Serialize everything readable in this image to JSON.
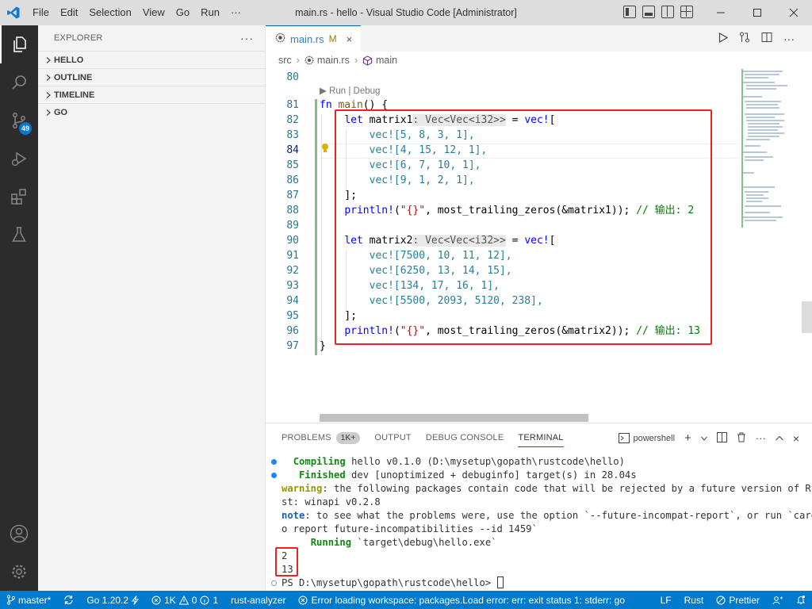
{
  "window": {
    "title": "main.rs - hello - Visual Studio Code [Administrator]",
    "menu": [
      "File",
      "Edit",
      "Selection",
      "View",
      "Go",
      "Run",
      "···"
    ]
  },
  "activity": {
    "scm_badge": "49"
  },
  "sidebar": {
    "title": "EXPLORER",
    "more": "···",
    "sections": [
      "HELLO",
      "OUTLINE",
      "TIMELINE",
      "GO"
    ]
  },
  "tab": {
    "name": "main.rs",
    "status": "M",
    "close": "×"
  },
  "breadcrumb": {
    "folder": "src",
    "file": "main.rs",
    "symbol": "main"
  },
  "editor": {
    "codelens": "▶ Run | Debug",
    "line_numbers": [
      "80",
      "81",
      "82",
      "83",
      "84",
      "85",
      "86",
      "87",
      "88",
      "89",
      "90",
      "91",
      "92",
      "93",
      "94",
      "95",
      "96",
      "97"
    ],
    "lines": {
      "l81_kw": "fn",
      "l81_fn": "main",
      "l81_rest": "() {",
      "l82_kw": "let",
      "l82_var": " matrix1",
      "l82_hint": ": Vec<Vec<i32>>",
      "l82_eq": " = ",
      "l82_mac": "vec!",
      "l82_br": "[",
      "l83": "vec![5, 8, 3, 1],",
      "l84": "vec![4, 15, 12, 1],",
      "l85": "vec![6, 7, 10, 1],",
      "l86": "vec![9, 1, 2, 1],",
      "l87": "];",
      "l88_mac": "println!",
      "l88_args1": "(",
      "l88_str": "\"{}\"",
      "l88_args2": ", most_trailing_zeros(&matrix1)); ",
      "l88_cmt": "// 输出: 2",
      "l90_kw": "let",
      "l90_var": " matrix2",
      "l90_hint": ": Vec<Vec<i32>>",
      "l90_eq": " = ",
      "l90_mac": "vec!",
      "l90_br": "[",
      "l91": "vec![7500, 10, 11, 12],",
      "l92": "vec![6250, 13, 14, 15],",
      "l93": "vec![134, 17, 16, 1],",
      "l94": "vec![5500, 2093, 5120, 238],",
      "l95": "];",
      "l96_mac": "println!",
      "l96_args1": "(",
      "l96_str": "\"{}\"",
      "l96_args2": ", most_trailing_zeros(&matrix2)); ",
      "l96_cmt": "// 输出: 13",
      "l97": "}"
    }
  },
  "panel": {
    "tabs": [
      "PROBLEMS",
      "1K+",
      "OUTPUT",
      "DEBUG CONSOLE",
      "TERMINAL"
    ],
    "shell": "powershell",
    "terminal": {
      "compiling_kw": "Compiling",
      "compiling_rest": " hello v0.1.0 (D:\\mysetup\\gopath\\rustcode\\hello)",
      "finished_kw": "Finished",
      "finished_rest": " dev [unoptimized + debuginfo] target(s) in 28.04s",
      "warning_kw": "warning",
      "warning_rest": ": the following packages contain code that will be rejected by a future version of Ru",
      "warning_cont": "st: winapi v0.2.8",
      "note_kw": "note",
      "note_rest": ": to see what the problems were, use the option `--future-incompat-report`, or run `carg",
      "note_cont": "o report future-incompatibilities --id 1459`",
      "running_kw": "Running",
      "running_rest": " `target\\debug\\hello.exe`",
      "out1": "2",
      "out2": "13",
      "prompt": "PS D:\\mysetup\\gopath\\rustcode\\hello> "
    }
  },
  "statusbar": {
    "branch": "master*",
    "go_version": "Go 1.20.2",
    "errors": "1K",
    "warnings": "0",
    "info": "1",
    "rust_analyzer": "rust-analyzer",
    "error_msg": "Error loading workspace: packages.Load error: err: exit status 1: stderr: go",
    "eol": "LF",
    "language": "Rust",
    "prettier": "Prettier"
  },
  "colors": {
    "accent": "#007acc",
    "highlight_box": "#ee2222",
    "activity_bg": "#2c2c2c"
  }
}
